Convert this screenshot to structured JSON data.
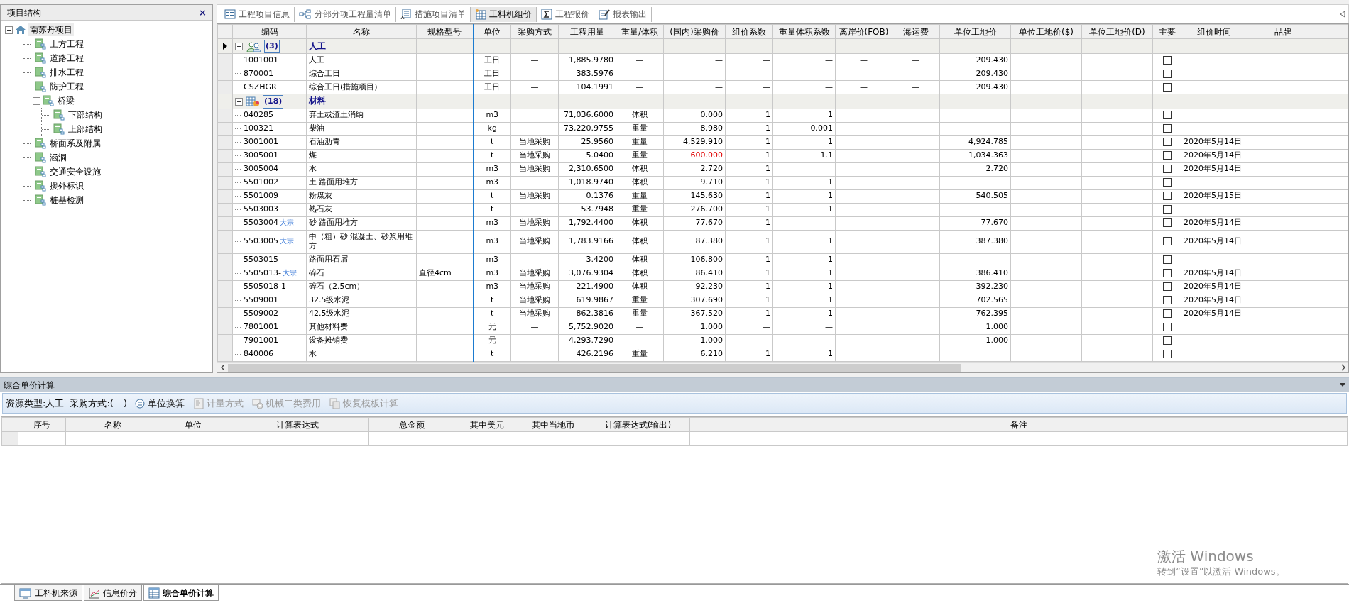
{
  "tree_panel": {
    "title": "项目结构",
    "close": "×",
    "root": {
      "label": "南苏丹项目",
      "expanded": true,
      "children": [
        {
          "label": "土方工程"
        },
        {
          "label": "道路工程"
        },
        {
          "label": "排水工程"
        },
        {
          "label": "防护工程"
        },
        {
          "label": "桥梁",
          "expanded": true,
          "children": [
            {
              "label": "下部结构"
            },
            {
              "label": "上部结构"
            }
          ]
        },
        {
          "label": "桥面系及附属"
        },
        {
          "label": "涵洞"
        },
        {
          "label": "交通安全设施"
        },
        {
          "label": "援外标识"
        },
        {
          "label": "桩基检测"
        }
      ]
    }
  },
  "toolbar_tabs": [
    {
      "label": "工程项目信息",
      "selected": false
    },
    {
      "label": "分部分项工程量清单",
      "selected": false
    },
    {
      "label": "措施项目清单",
      "selected": false
    },
    {
      "label": "工料机组价",
      "selected": true
    },
    {
      "label": "工程报价",
      "selected": false
    },
    {
      "label": "报表输出",
      "selected": false
    }
  ],
  "table": {
    "columns": [
      {
        "label": "编码",
        "kind": "code"
      },
      {
        "label": "名称",
        "kind": "text"
      },
      {
        "label": "规格型号",
        "kind": "text"
      },
      {
        "label": "单位",
        "kind": "center"
      },
      {
        "label": "采购方式",
        "kind": "center"
      },
      {
        "label": "工程用量",
        "kind": "number"
      },
      {
        "label": "重量/体积",
        "kind": "center"
      },
      {
        "label": "(国内)采购价",
        "kind": "number"
      },
      {
        "label": "组价系数",
        "kind": "number"
      },
      {
        "label": "重量体积系数",
        "kind": "number"
      },
      {
        "label": "离岸价(FOB)",
        "kind": "center"
      },
      {
        "label": "海运费",
        "kind": "center"
      },
      {
        "label": "单位工地价",
        "kind": "number"
      },
      {
        "label": "单位工地价($)",
        "kind": "number"
      },
      {
        "label": "单位工地价(D)",
        "kind": "number"
      },
      {
        "label": "主要",
        "kind": "check"
      },
      {
        "label": "组价时间",
        "kind": "text"
      },
      {
        "label": "品牌",
        "kind": "text"
      }
    ],
    "groups": [
      {
        "count": "(3)",
        "name": "人工",
        "expanded": true,
        "current": true,
        "rows": [
          {
            "cells": [
              "1001001",
              "人工",
              null,
              "工日",
              "—",
              "1,885.9780",
              "—",
              "—",
              "—",
              "—",
              "—",
              "—",
              "209.430",
              null,
              null,
              null,
              null,
              null
            ],
            "main": false,
            "price_alert": false
          },
          {
            "cells": [
              "870001",
              "综合工日",
              null,
              "工日",
              "—",
              "383.5976",
              "—",
              "—",
              "—",
              "—",
              "—",
              "—",
              "209.430",
              null,
              null,
              null,
              null,
              null
            ],
            "main": false,
            "price_alert": false
          },
          {
            "cells": [
              "CSZHGR",
              "综合工日(措施项目)",
              null,
              "工日",
              "—",
              "104.1991",
              "—",
              "—",
              "—",
              "—",
              "—",
              "—",
              "209.430",
              null,
              null,
              null,
              null,
              null
            ],
            "main": false,
            "price_alert": false
          }
        ]
      },
      {
        "count": "(18)",
        "name": "材料",
        "expanded": true,
        "current": false,
        "rows": [
          {
            "cells": [
              "040285",
              "弃土或渣土消纳",
              null,
              "m3",
              null,
              "71,036.6000",
              "体积",
              "0.000",
              "1",
              "1",
              null,
              null,
              null,
              null,
              null,
              null,
              null,
              null
            ],
            "main": false,
            "price_alert": false
          },
          {
            "cells": [
              "100321",
              "柴油",
              null,
              "kg",
              null,
              "73,220.9755",
              "重量",
              "8.980",
              "1",
              "0.001",
              null,
              null,
              null,
              null,
              null,
              null,
              null,
              null
            ],
            "main": false,
            "price_alert": false
          },
          {
            "cells": [
              "3001001",
              "石油沥青",
              null,
              "t",
              "当地采购",
              "25.9560",
              "重量",
              "4,529.910",
              "1",
              "1",
              null,
              null,
              "4,924.785",
              null,
              null,
              null,
              "2020年5月14日",
              null
            ],
            "main": false,
            "price_alert": false
          },
          {
            "cells": [
              "3005001",
              "煤",
              null,
              "t",
              "当地采购",
              "5.0400",
              "重量",
              "600.000",
              "1",
              "1.1",
              null,
              null,
              "1,034.363",
              null,
              null,
              null,
              "2020年5月14日",
              null
            ],
            "main": false,
            "price_alert": true
          },
          {
            "cells": [
              "3005004",
              "水",
              null,
              "m3",
              "当地采购",
              "2,310.6500",
              "体积",
              "2.720",
              "1",
              null,
              null,
              null,
              "2.720",
              null,
              null,
              null,
              "2020年5月14日",
              null
            ],
            "main": false,
            "price_alert": false
          },
          {
            "cells": [
              "5501002",
              "土 路面用堆方",
              null,
              "m3",
              null,
              "1,018.9740",
              "体积",
              "9.710",
              "1",
              "1",
              null,
              null,
              null,
              null,
              null,
              null,
              null,
              null
            ],
            "main": false,
            "price_alert": false
          },
          {
            "cells": [
              "5501009",
              "粉煤灰",
              null,
              "t",
              "当地采购",
              "0.1376",
              "重量",
              "145.630",
              "1",
              "1",
              null,
              null,
              "540.505",
              null,
              null,
              null,
              "2020年5月15日",
              null
            ],
            "main": false,
            "price_alert": false
          },
          {
            "cells": [
              "5503003",
              "熟石灰",
              null,
              "t",
              null,
              "53.7948",
              "重量",
              "276.700",
              "1",
              "1",
              null,
              null,
              null,
              null,
              null,
              null,
              null,
              null
            ],
            "main": false,
            "price_alert": false
          },
          {
            "cells": [
              "5503004",
              "砂 路面用堆方",
              null,
              "m3",
              "当地采购",
              "1,792.4400",
              "体积",
              "77.670",
              "1",
              null,
              null,
              null,
              "77.670",
              null,
              null,
              null,
              "2020年5月14日",
              null
            ],
            "main": false,
            "price_alert": false,
            "tag": "大宗"
          },
          {
            "cells": [
              "5503005",
              "中（粗）砂 混凝土、砂浆用堆方",
              null,
              "m3",
              "当地采购",
              "1,783.9166",
              "体积",
              "87.380",
              "1",
              "1",
              null,
              null,
              "387.380",
              null,
              null,
              null,
              "2020年5月14日",
              null
            ],
            "main": false,
            "price_alert": false,
            "tag": "大宗"
          },
          {
            "cells": [
              "5503015",
              "路面用石屑",
              null,
              "m3",
              null,
              "3.4200",
              "体积",
              "106.800",
              "1",
              "1",
              null,
              null,
              null,
              null,
              null,
              null,
              null,
              null
            ],
            "main": false,
            "price_alert": false
          },
          {
            "cells": [
              "5505013-",
              "碎石",
              "直径4cm",
              "m3",
              "当地采购",
              "3,076.9304",
              "体积",
              "86.410",
              "1",
              "1",
              null,
              null,
              "386.410",
              null,
              null,
              null,
              "2020年5月14日",
              null
            ],
            "main": false,
            "price_alert": false,
            "tag": "大宗"
          },
          {
            "cells": [
              "5505018-1",
              "碎石（2.5cm）",
              null,
              "m3",
              "当地采购",
              "221.4900",
              "体积",
              "92.230",
              "1",
              "1",
              null,
              null,
              "392.230",
              null,
              null,
              null,
              "2020年5月14日",
              null
            ],
            "main": false,
            "price_alert": false
          },
          {
            "cells": [
              "5509001",
              "32.5级水泥",
              null,
              "t",
              "当地采购",
              "619.9867",
              "重量",
              "307.690",
              "1",
              "1",
              null,
              null,
              "702.565",
              null,
              null,
              null,
              "2020年5月14日",
              null
            ],
            "main": false,
            "price_alert": false
          },
          {
            "cells": [
              "5509002",
              "42.5级水泥",
              null,
              "t",
              "当地采购",
              "862.3816",
              "重量",
              "367.520",
              "1",
              "1",
              null,
              null,
              "762.395",
              null,
              null,
              null,
              "2020年5月14日",
              null
            ],
            "main": false,
            "price_alert": false
          },
          {
            "cells": [
              "7801001",
              "其他材料费",
              null,
              "元",
              "—",
              "5,752.9020",
              "—",
              "1.000",
              "—",
              "—",
              null,
              null,
              "1.000",
              null,
              null,
              null,
              null,
              null
            ],
            "main": false,
            "price_alert": false
          },
          {
            "cells": [
              "7901001",
              "设备摊销费",
              null,
              "元",
              "—",
              "4,293.7290",
              "—",
              "1.000",
              "—",
              "—",
              null,
              null,
              "1.000",
              null,
              null,
              null,
              null,
              null
            ],
            "main": false,
            "price_alert": false
          },
          {
            "cells": [
              "840006",
              "水",
              null,
              "t",
              null,
              "426.2196",
              "重量",
              "6.210",
              "1",
              "1",
              null,
              null,
              null,
              null,
              null,
              null,
              null,
              null
            ],
            "main": false,
            "price_alert": false
          }
        ]
      }
    ]
  },
  "calc_panel": {
    "title": "综合单价计算",
    "resource_type": "资源类型:人工",
    "purchase_mode": "采购方式:(---)",
    "buttons": [
      {
        "label": "单位换算",
        "disabled": false
      },
      {
        "label": "计量方式",
        "disabled": true
      },
      {
        "label": "机械二类费用",
        "disabled": true
      },
      {
        "label": "恢复模板计算",
        "disabled": true
      }
    ],
    "columns": [
      "序号",
      "名称",
      "单位",
      "计算表达式",
      "总金额",
      "其中美元",
      "其中当地币",
      "计算表达式(输出)",
      "备注"
    ]
  },
  "bottom_tabs": [
    {
      "label": "工料机来源",
      "selected": false
    },
    {
      "label": "信息价分",
      "selected": false
    },
    {
      "label": "综合单价计算",
      "selected": true
    }
  ],
  "os_notice": {
    "title": "激活 Windows",
    "text": "转到“设置”以激活 Windows。"
  }
}
